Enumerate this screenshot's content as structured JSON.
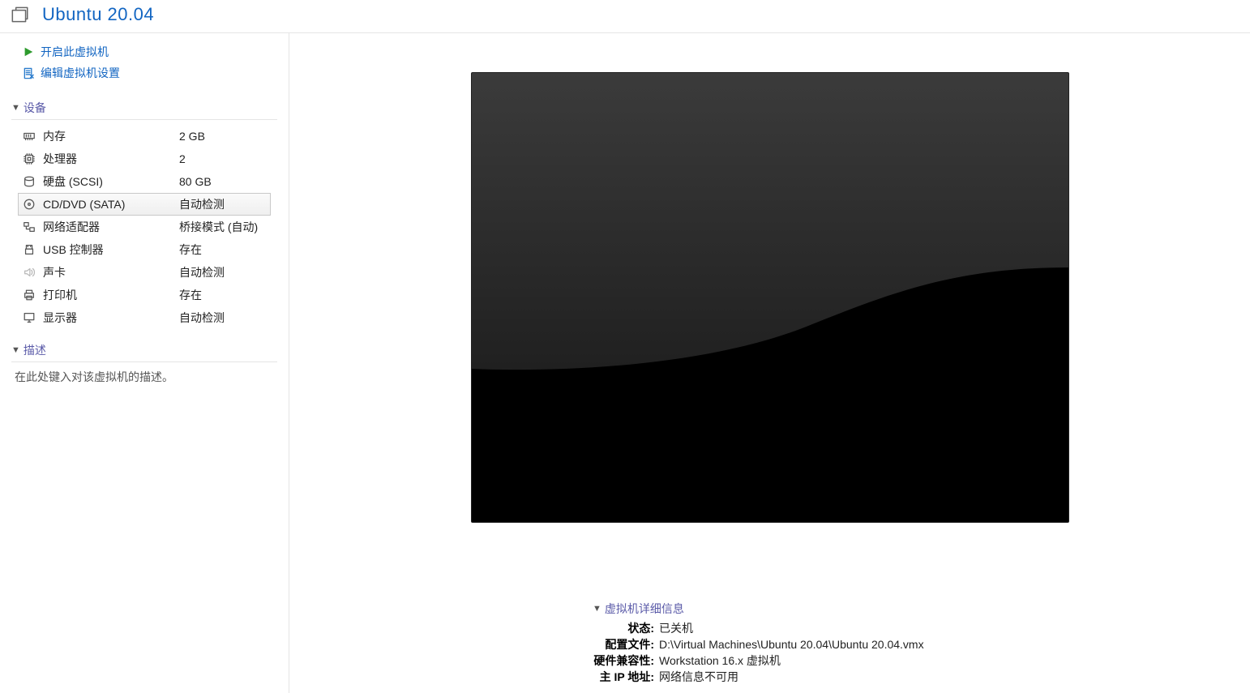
{
  "title": "Ubuntu 20.04",
  "actions": {
    "power_on": "开启此虚拟机",
    "edit_settings": "编辑虚拟机设置"
  },
  "sections": {
    "devices_label": "设备",
    "description_label": "描述",
    "details_label": "虚拟机详细信息"
  },
  "devices": [
    {
      "name": "内存",
      "value": "2 GB",
      "icon": "memory-icon",
      "selected": false
    },
    {
      "name": "处理器",
      "value": "2",
      "icon": "cpu-icon",
      "selected": false
    },
    {
      "name": "硬盘 (SCSI)",
      "value": "80 GB",
      "icon": "disk-icon",
      "selected": false
    },
    {
      "name": "CD/DVD (SATA)",
      "value": "自动检测",
      "icon": "cd-icon",
      "selected": true
    },
    {
      "name": "网络适配器",
      "value": "桥接模式 (自动)",
      "icon": "network-icon",
      "selected": false
    },
    {
      "name": "USB 控制器",
      "value": "存在",
      "icon": "usb-icon",
      "selected": false
    },
    {
      "name": "声卡",
      "value": "自动检测",
      "icon": "sound-icon",
      "selected": false
    },
    {
      "name": "打印机",
      "value": "存在",
      "icon": "printer-icon",
      "selected": false
    },
    {
      "name": "显示器",
      "value": "自动检测",
      "icon": "display-icon",
      "selected": false
    }
  ],
  "description_placeholder": "在此处键入对该虚拟机的描述。",
  "details": {
    "state_label": "状态:",
    "state_value": "已关机",
    "config_label": "配置文件:",
    "config_value": "D:\\Virtual Machines\\Ubuntu 20.04\\Ubuntu 20.04.vmx",
    "compat_label": "硬件兼容性:",
    "compat_value": "Workstation 16.x 虚拟机",
    "ip_label": "主 IP 地址:",
    "ip_value": "网络信息不可用"
  }
}
